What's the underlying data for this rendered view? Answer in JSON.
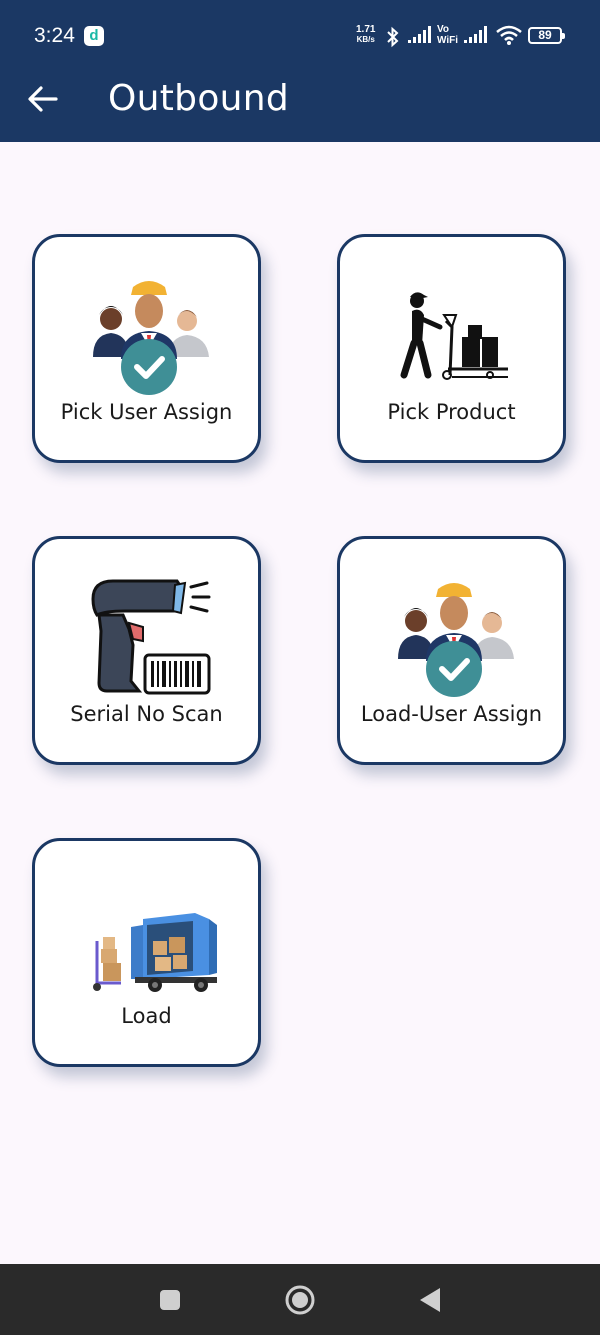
{
  "status_bar": {
    "time": "3:24",
    "app_icon": "d",
    "net_speed_value": "1.71",
    "net_speed_unit": "KB/s",
    "vo_label": "Vo",
    "wifi_label": "WiFi",
    "battery": "89"
  },
  "app_bar": {
    "title": "Outbound",
    "background": "#1b3864"
  },
  "tiles": [
    {
      "label": "Pick User Assign",
      "icon": "team-check-icon"
    },
    {
      "label": "Pick Product",
      "icon": "worker-pallet-jack-icon"
    },
    {
      "label": "Serial No Scan",
      "icon": "barcode-scanner-icon"
    },
    {
      "label": "Load-User Assign",
      "icon": "team-check-icon"
    },
    {
      "label": "Load",
      "icon": "delivery-truck-icon"
    }
  ],
  "nav_bar": {
    "buttons": [
      "recents-square-icon",
      "home-circle-icon",
      "back-triangle-icon"
    ]
  }
}
